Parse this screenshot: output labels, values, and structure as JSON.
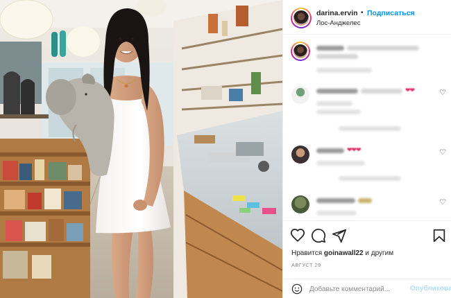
{
  "post": {
    "username": "darina.ervin",
    "separator": "•",
    "follow_label": "Подписаться",
    "location": "Лос-Анджелес"
  },
  "actions": {
    "like_icon": "heart-outline-icon",
    "comment_icon": "comment-bubble-icon",
    "share_icon": "paper-plane-icon",
    "save_icon": "bookmark-icon"
  },
  "likes": {
    "prefix": "Нравится",
    "user": "goinawall22",
    "suffix": "и другим"
  },
  "date": "АВГУСТ 29",
  "add_comment": {
    "placeholder": "Добавьте комментарий...",
    "publish_label": "Опубликовать"
  },
  "colors": {
    "accent": "#0095f6",
    "publish_disabled": "#b2dffc",
    "heart": "#e0245e"
  }
}
